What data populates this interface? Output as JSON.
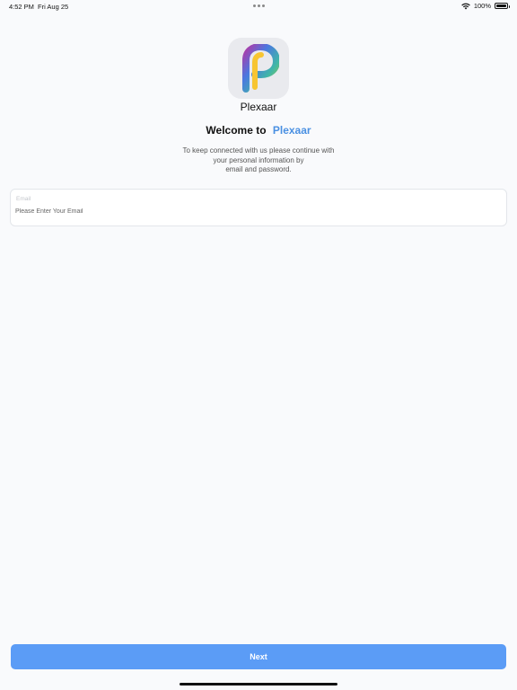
{
  "status_bar": {
    "time": "4:52 PM",
    "date": "Fri Aug 25",
    "battery": "100%",
    "battery_level": 1.0
  },
  "app": {
    "name": "Plexaar",
    "icon": "plexaar-logo-icon"
  },
  "welcome": {
    "prefix": "Welcome to",
    "brand": "Plexaar"
  },
  "subtitle": {
    "line1": "To keep connected with us please continue with",
    "line2": "your personal information by",
    "line3": "email and password."
  },
  "email": {
    "label": "Email",
    "placeholder": "Please Enter Your Email",
    "value": ""
  },
  "actions": {
    "next_label": "Next"
  },
  "colors": {
    "accent": "#4a90e2",
    "button": "#5b9cf6",
    "background": "#f9fafc"
  }
}
